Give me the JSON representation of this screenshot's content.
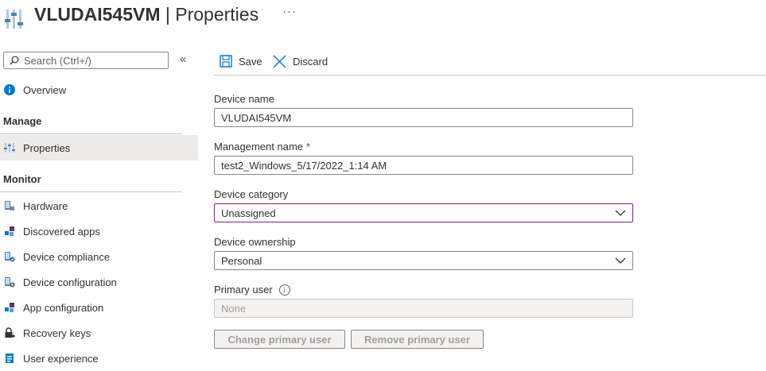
{
  "header": {
    "device_name": "VLUDAI545VM",
    "separator": " | ",
    "page": "Properties",
    "more": "···"
  },
  "sidebar": {
    "search_placeholder": "Search (Ctrl+/)",
    "collapse": "«",
    "overview": "Overview",
    "section_manage": "Manage",
    "properties": "Properties",
    "section_monitor": "Monitor",
    "items": [
      {
        "label": "Hardware",
        "icon": "hardware-icon"
      },
      {
        "label": "Discovered apps",
        "icon": "discovered-apps-icon"
      },
      {
        "label": "Device compliance",
        "icon": "device-compliance-icon"
      },
      {
        "label": "Device configuration",
        "icon": "device-configuration-icon"
      },
      {
        "label": "App configuration",
        "icon": "app-configuration-icon"
      },
      {
        "label": "Recovery keys",
        "icon": "lock-icon"
      },
      {
        "label": "User experience",
        "icon": "user-experience-icon"
      }
    ]
  },
  "toolbar": {
    "save": "Save",
    "discard": "Discard"
  },
  "form": {
    "device_name_label": "Device name",
    "device_name_value": "VLUDAI545VM",
    "management_name_label": "Management name",
    "required_mark": "*",
    "management_name_value": "test2_Windows_5/17/2022_1:14 AM",
    "device_category_label": "Device category",
    "device_category_value": "Unassigned",
    "device_ownership_label": "Device ownership",
    "device_ownership_value": "Personal",
    "primary_user_label": "Primary user",
    "primary_user_value": "None",
    "change_primary_user": "Change primary user",
    "remove_primary_user": "Remove primary user"
  },
  "colors": {
    "accent_focus": "#6b2c73",
    "save_icon": "#0078d4",
    "info_blue": "#0078d4"
  }
}
